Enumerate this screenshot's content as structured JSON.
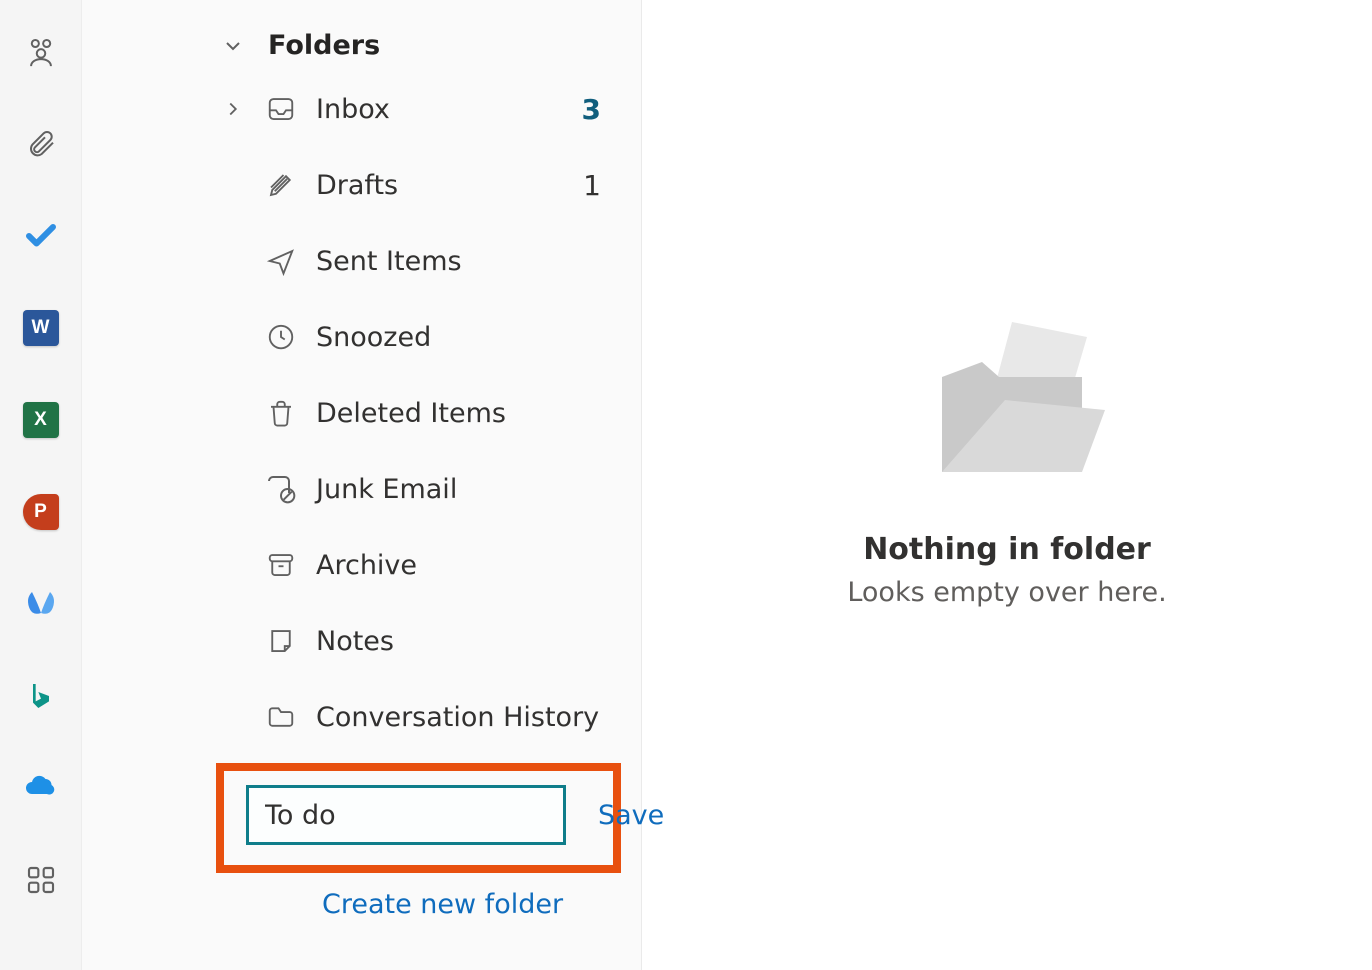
{
  "folders": {
    "header": "Folders",
    "items": [
      {
        "label": "Inbox",
        "count": "3"
      },
      {
        "label": "Drafts",
        "count": "1"
      },
      {
        "label": "Sent Items"
      },
      {
        "label": "Snoozed"
      },
      {
        "label": "Deleted Items"
      },
      {
        "label": "Junk Email"
      },
      {
        "label": "Archive"
      },
      {
        "label": "Notes"
      },
      {
        "label": "Conversation History"
      }
    ],
    "new_folder_value": "To do",
    "save_button": "Save",
    "create_link": "Create new folder"
  },
  "empty_state": {
    "title": "Nothing in folder",
    "subtitle": "Looks empty over here."
  },
  "app_rail": {
    "icons": [
      "people",
      "attachment",
      "todo",
      "word",
      "excel",
      "powerpoint",
      "viva",
      "bing",
      "onedrive",
      "more-apps"
    ]
  }
}
